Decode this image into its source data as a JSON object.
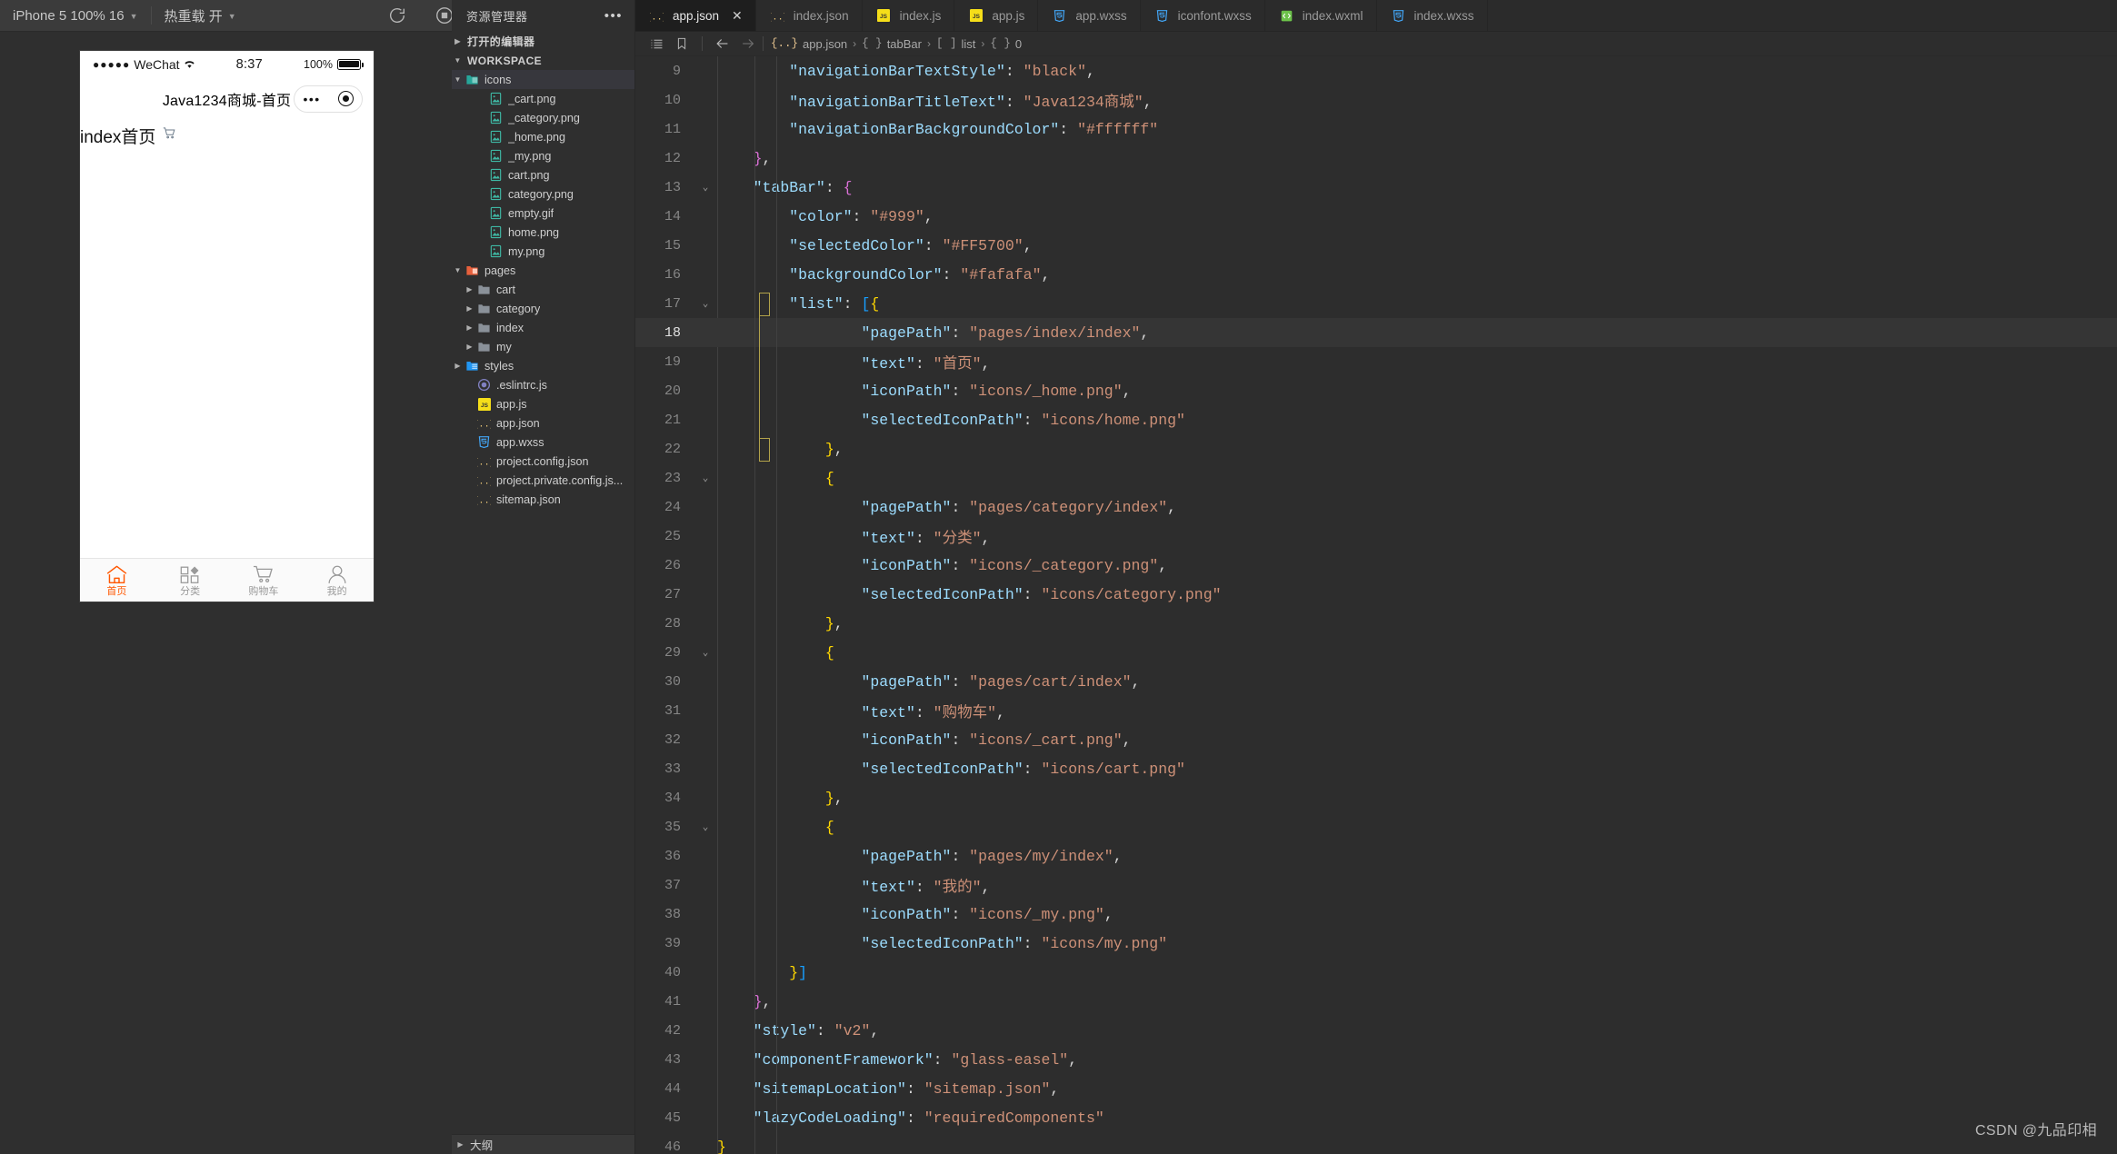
{
  "toolbar": {
    "device_label": "iPhone 5 100% 16",
    "hotreload_label": "热重载 开",
    "icons": [
      "refresh-icon",
      "record-stop-icon",
      "phone-icon",
      "multi-window-icon"
    ]
  },
  "simulator": {
    "status_bar": {
      "carrier": "WeChat",
      "signal_dots": "●●●●●",
      "time": "8:37",
      "battery_text": "100%"
    },
    "nav_bar": {
      "title": "Java1234商城-首页",
      "capsule_dots": "•••"
    },
    "page": {
      "text": "index首页",
      "icon": "cart-outline-icon"
    },
    "tabbar": {
      "background": "#fafafa",
      "color": "#999999",
      "selected_color": "#FF5700",
      "items": [
        {
          "label": "首页",
          "icon": "home-icon",
          "selected": true
        },
        {
          "label": "分类",
          "icon": "category-icon",
          "selected": false
        },
        {
          "label": "购物车",
          "icon": "cart-icon",
          "selected": false
        },
        {
          "label": "我的",
          "icon": "user-icon",
          "selected": false
        }
      ]
    }
  },
  "explorer": {
    "title": "资源管理器",
    "more_icon": "ellipsis-icon",
    "sections": [
      {
        "label": "打开的编辑器",
        "expanded": false
      },
      {
        "label": "WORKSPACE",
        "expanded": true
      }
    ],
    "tree": [
      {
        "label": "icons",
        "type": "folder-img",
        "depth": 1,
        "expanded": true,
        "selected": true
      },
      {
        "label": "_cart.png",
        "type": "image",
        "depth": 3
      },
      {
        "label": "_category.png",
        "type": "image",
        "depth": 3
      },
      {
        "label": "_home.png",
        "type": "image",
        "depth": 3
      },
      {
        "label": "_my.png",
        "type": "image",
        "depth": 3
      },
      {
        "label": "cart.png",
        "type": "image",
        "depth": 3
      },
      {
        "label": "category.png",
        "type": "image",
        "depth": 3
      },
      {
        "label": "empty.gif",
        "type": "image",
        "depth": 3
      },
      {
        "label": "home.png",
        "type": "image",
        "depth": 3
      },
      {
        "label": "my.png",
        "type": "image",
        "depth": 3
      },
      {
        "label": "pages",
        "type": "folder-page",
        "depth": 1,
        "expanded": true
      },
      {
        "label": "cart",
        "type": "folder",
        "depth": 2,
        "expanded": false
      },
      {
        "label": "category",
        "type": "folder",
        "depth": 2,
        "expanded": false
      },
      {
        "label": "index",
        "type": "folder",
        "depth": 2,
        "expanded": false
      },
      {
        "label": "my",
        "type": "folder",
        "depth": 2,
        "expanded": false
      },
      {
        "label": "styles",
        "type": "folder-css",
        "depth": 1,
        "expanded": false
      },
      {
        "label": ".eslintrc.js",
        "type": "eslint",
        "depth": 2
      },
      {
        "label": "app.js",
        "type": "js",
        "depth": 2
      },
      {
        "label": "app.json",
        "type": "json",
        "depth": 2
      },
      {
        "label": "app.wxss",
        "type": "css",
        "depth": 2
      },
      {
        "label": "project.config.json",
        "type": "json",
        "depth": 2
      },
      {
        "label": "project.private.config.js...",
        "type": "json",
        "depth": 2
      },
      {
        "label": "sitemap.json",
        "type": "json",
        "depth": 2
      }
    ],
    "footer": {
      "label": "大纲"
    }
  },
  "editor": {
    "tabs": [
      {
        "label": "app.json",
        "type": "json",
        "active": true,
        "close": "✕"
      },
      {
        "label": "index.json",
        "type": "json",
        "active": false
      },
      {
        "label": "index.js",
        "type": "js",
        "active": false
      },
      {
        "label": "app.js",
        "type": "js",
        "active": false
      },
      {
        "label": "app.wxss",
        "type": "css",
        "active": false
      },
      {
        "label": "iconfont.wxss",
        "type": "css",
        "active": false
      },
      {
        "label": "index.wxml",
        "type": "wxml",
        "active": false
      },
      {
        "label": "index.wxss",
        "type": "css",
        "active": false
      }
    ],
    "breadcrumb": {
      "icons": [
        "list-icon",
        "bookmark-icon",
        "arrow-left-icon",
        "arrow-right-icon"
      ],
      "crumbs": [
        {
          "icon": "json-icon",
          "label": "app.json"
        },
        {
          "icon": "brace-icon",
          "label": "tabBar"
        },
        {
          "icon": "array-icon",
          "label": "list"
        },
        {
          "icon": "brace-icon",
          "label": "0"
        }
      ]
    },
    "active_line": 18,
    "lines": [
      {
        "n": 9,
        "indent": 2,
        "fold": "",
        "tokens": [
          [
            "k",
            "\"navigationBarTextStyle\""
          ],
          [
            "p",
            ": "
          ],
          [
            "s",
            "\"black\""
          ],
          [
            "p",
            ","
          ]
        ]
      },
      {
        "n": 10,
        "indent": 2,
        "fold": "",
        "tokens": [
          [
            "k",
            "\"navigationBarTitleText\""
          ],
          [
            "p",
            ": "
          ],
          [
            "s",
            "\"Java1234商城\""
          ],
          [
            "p",
            ","
          ]
        ]
      },
      {
        "n": 11,
        "indent": 2,
        "fold": "",
        "tokens": [
          [
            "k",
            "\"navigationBarBackgroundColor\""
          ],
          [
            "p",
            ": "
          ],
          [
            "s",
            "\"#ffffff\""
          ]
        ]
      },
      {
        "n": 12,
        "indent": 1,
        "fold": "",
        "tokens": [
          [
            "b2",
            "}"
          ],
          [
            "p",
            ","
          ]
        ]
      },
      {
        "n": 13,
        "indent": 1,
        "fold": "v",
        "tokens": [
          [
            "k",
            "\"tabBar\""
          ],
          [
            "p",
            ": "
          ],
          [
            "b2",
            "{"
          ]
        ]
      },
      {
        "n": 14,
        "indent": 2,
        "fold": "",
        "tokens": [
          [
            "k",
            "\"color\""
          ],
          [
            "p",
            ": "
          ],
          [
            "s",
            "\"#999\""
          ],
          [
            "p",
            ","
          ]
        ]
      },
      {
        "n": 15,
        "indent": 2,
        "fold": "",
        "tokens": [
          [
            "k",
            "\"selectedColor\""
          ],
          [
            "p",
            ": "
          ],
          [
            "s",
            "\"#FF5700\""
          ],
          [
            "p",
            ","
          ]
        ]
      },
      {
        "n": 16,
        "indent": 2,
        "fold": "",
        "tokens": [
          [
            "k",
            "\"backgroundColor\""
          ],
          [
            "p",
            ": "
          ],
          [
            "s",
            "\"#fafafa\""
          ],
          [
            "p",
            ","
          ]
        ]
      },
      {
        "n": 17,
        "indent": 2,
        "fold": "v",
        "tokens": [
          [
            "k",
            "\"list\""
          ],
          [
            "p",
            ": "
          ],
          [
            "b3",
            "["
          ],
          [
            "b1",
            "{"
          ]
        ]
      },
      {
        "n": 18,
        "indent": 4,
        "fold": "",
        "tokens": [
          [
            "k",
            "\"pagePath\""
          ],
          [
            "p",
            ": "
          ],
          [
            "s",
            "\"pages/index/index\""
          ],
          [
            "p",
            ","
          ]
        ]
      },
      {
        "n": 19,
        "indent": 4,
        "fold": "",
        "tokens": [
          [
            "k",
            "\"text\""
          ],
          [
            "p",
            ": "
          ],
          [
            "s",
            "\"首页\""
          ],
          [
            "p",
            ","
          ]
        ]
      },
      {
        "n": 20,
        "indent": 4,
        "fold": "",
        "tokens": [
          [
            "k",
            "\"iconPath\""
          ],
          [
            "p",
            ": "
          ],
          [
            "s",
            "\"icons/_home.png\""
          ],
          [
            "p",
            ","
          ]
        ]
      },
      {
        "n": 21,
        "indent": 4,
        "fold": "",
        "tokens": [
          [
            "k",
            "\"selectedIconPath\""
          ],
          [
            "p",
            ": "
          ],
          [
            "s",
            "\"icons/home.png\""
          ]
        ]
      },
      {
        "n": 22,
        "indent": 3,
        "fold": "",
        "tokens": [
          [
            "b1",
            "}"
          ],
          [
            "p",
            ","
          ]
        ]
      },
      {
        "n": 23,
        "indent": 3,
        "fold": "v",
        "tokens": [
          [
            "b1",
            "{"
          ]
        ]
      },
      {
        "n": 24,
        "indent": 4,
        "fold": "",
        "tokens": [
          [
            "k",
            "\"pagePath\""
          ],
          [
            "p",
            ": "
          ],
          [
            "s",
            "\"pages/category/index\""
          ],
          [
            "p",
            ","
          ]
        ]
      },
      {
        "n": 25,
        "indent": 4,
        "fold": "",
        "tokens": [
          [
            "k",
            "\"text\""
          ],
          [
            "p",
            ": "
          ],
          [
            "s",
            "\"分类\""
          ],
          [
            "p",
            ","
          ]
        ]
      },
      {
        "n": 26,
        "indent": 4,
        "fold": "",
        "tokens": [
          [
            "k",
            "\"iconPath\""
          ],
          [
            "p",
            ": "
          ],
          [
            "s",
            "\"icons/_category.png\""
          ],
          [
            "p",
            ","
          ]
        ]
      },
      {
        "n": 27,
        "indent": 4,
        "fold": "",
        "tokens": [
          [
            "k",
            "\"selectedIconPath\""
          ],
          [
            "p",
            ": "
          ],
          [
            "s",
            "\"icons/category.png\""
          ]
        ]
      },
      {
        "n": 28,
        "indent": 3,
        "fold": "",
        "tokens": [
          [
            "b1",
            "}"
          ],
          [
            "p",
            ","
          ]
        ]
      },
      {
        "n": 29,
        "indent": 3,
        "fold": "v",
        "tokens": [
          [
            "b1",
            "{"
          ]
        ]
      },
      {
        "n": 30,
        "indent": 4,
        "fold": "",
        "tokens": [
          [
            "k",
            "\"pagePath\""
          ],
          [
            "p",
            ": "
          ],
          [
            "s",
            "\"pages/cart/index\""
          ],
          [
            "p",
            ","
          ]
        ]
      },
      {
        "n": 31,
        "indent": 4,
        "fold": "",
        "tokens": [
          [
            "k",
            "\"text\""
          ],
          [
            "p",
            ": "
          ],
          [
            "s",
            "\"购物车\""
          ],
          [
            "p",
            ","
          ]
        ]
      },
      {
        "n": 32,
        "indent": 4,
        "fold": "",
        "tokens": [
          [
            "k",
            "\"iconPath\""
          ],
          [
            "p",
            ": "
          ],
          [
            "s",
            "\"icons/_cart.png\""
          ],
          [
            "p",
            ","
          ]
        ]
      },
      {
        "n": 33,
        "indent": 4,
        "fold": "",
        "tokens": [
          [
            "k",
            "\"selectedIconPath\""
          ],
          [
            "p",
            ": "
          ],
          [
            "s",
            "\"icons/cart.png\""
          ]
        ]
      },
      {
        "n": 34,
        "indent": 3,
        "fold": "",
        "tokens": [
          [
            "b1",
            "}"
          ],
          [
            "p",
            ","
          ]
        ]
      },
      {
        "n": 35,
        "indent": 3,
        "fold": "v",
        "tokens": [
          [
            "b1",
            "{"
          ]
        ]
      },
      {
        "n": 36,
        "indent": 4,
        "fold": "",
        "tokens": [
          [
            "k",
            "\"pagePath\""
          ],
          [
            "p",
            ": "
          ],
          [
            "s",
            "\"pages/my/index\""
          ],
          [
            "p",
            ","
          ]
        ]
      },
      {
        "n": 37,
        "indent": 4,
        "fold": "",
        "tokens": [
          [
            "k",
            "\"text\""
          ],
          [
            "p",
            ": "
          ],
          [
            "s",
            "\"我的\""
          ],
          [
            "p",
            ","
          ]
        ]
      },
      {
        "n": 38,
        "indent": 4,
        "fold": "",
        "tokens": [
          [
            "k",
            "\"iconPath\""
          ],
          [
            "p",
            ": "
          ],
          [
            "s",
            "\"icons/_my.png\""
          ],
          [
            "p",
            ","
          ]
        ]
      },
      {
        "n": 39,
        "indent": 4,
        "fold": "",
        "tokens": [
          [
            "k",
            "\"selectedIconPath\""
          ],
          [
            "p",
            ": "
          ],
          [
            "s",
            "\"icons/my.png\""
          ]
        ]
      },
      {
        "n": 40,
        "indent": 2,
        "fold": "",
        "tokens": [
          [
            "b1",
            "}"
          ],
          [
            "b3",
            "]"
          ]
        ]
      },
      {
        "n": 41,
        "indent": 1,
        "fold": "",
        "tokens": [
          [
            "b2",
            "}"
          ],
          [
            "p",
            ","
          ]
        ]
      },
      {
        "n": 42,
        "indent": 1,
        "fold": "",
        "tokens": [
          [
            "k",
            "\"style\""
          ],
          [
            "p",
            ": "
          ],
          [
            "s",
            "\"v2\""
          ],
          [
            "p",
            ","
          ]
        ]
      },
      {
        "n": 43,
        "indent": 1,
        "fold": "",
        "tokens": [
          [
            "k",
            "\"componentFramework\""
          ],
          [
            "p",
            ": "
          ],
          [
            "s",
            "\"glass-easel\""
          ],
          [
            "p",
            ","
          ]
        ]
      },
      {
        "n": 44,
        "indent": 1,
        "fold": "",
        "tokens": [
          [
            "k",
            "\"sitemapLocation\""
          ],
          [
            "p",
            ": "
          ],
          [
            "s",
            "\"sitemap.json\""
          ],
          [
            "p",
            ","
          ]
        ]
      },
      {
        "n": 45,
        "indent": 1,
        "fold": "",
        "tokens": [
          [
            "k",
            "\"lazyCodeLoading\""
          ],
          [
            "p",
            ": "
          ],
          [
            "s",
            "\"requiredComponents\""
          ]
        ]
      },
      {
        "n": 46,
        "indent": 0,
        "fold": "",
        "tokens": [
          [
            "b1",
            "}"
          ]
        ]
      }
    ]
  },
  "watermark": {
    "text": "CSDN @九品印相"
  }
}
